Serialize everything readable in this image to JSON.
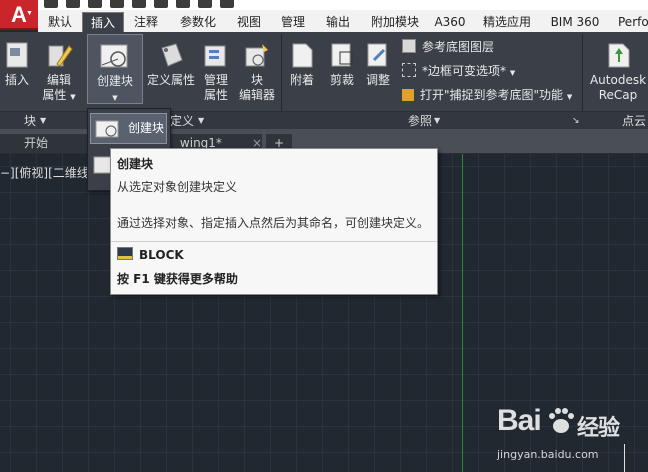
{
  "app": {
    "logo_letter": "A"
  },
  "tabs": [
    "默认",
    "插入",
    "注释",
    "参数化",
    "视图",
    "管理",
    "输出",
    "附加模块",
    "A360",
    "精选应用",
    "BIM 360",
    "Perfo"
  ],
  "active_tab_index": 1,
  "ribbon": {
    "block_panel": {
      "insert": "插入",
      "edit_attr_line1": "编辑",
      "edit_attr_line2": "属性",
      "create_block": "创建块",
      "define_attr": "定义属性",
      "manage_attr_line1": "管理",
      "manage_attr_line2": "属性",
      "block_editor_line1": "块",
      "block_editor_line2": "编辑器",
      "title": "块",
      "title2": "定义"
    },
    "reference_panel": {
      "attach": "附着",
      "clip": "剪裁",
      "adjust": "调整",
      "underlay_layers": "参考底图图层",
      "frame_variable": "*边框可变选项*",
      "snap_underlay": "打开\"捕捉到参考底图\"功能",
      "title": "参照"
    },
    "recap_panel": {
      "line1": "Autodesk",
      "line2": "ReCap",
      "title": "点云"
    }
  },
  "dropdown": {
    "item1": "创建块"
  },
  "doc_tabs": {
    "start": "开始",
    "drawing": "wing1*"
  },
  "viewport_label": "−][俯视][二维线",
  "tooltip": {
    "title": "创建块",
    "desc": "从选定对象创建块定义",
    "detail": "通过选择对象、指定插入点然后为其命名，可创建块定义。",
    "command": "BLOCK",
    "help": "按 F1 键获得更多帮助"
  },
  "watermark": {
    "brand": "Bai",
    "brand2": "经验",
    "url": "jingyan.baidu.com"
  },
  "colors": {
    "ribbon": "#3b4048",
    "canvas": "#212830",
    "accent_red": "#c9252b",
    "ycross": "#2f8a3a"
  }
}
